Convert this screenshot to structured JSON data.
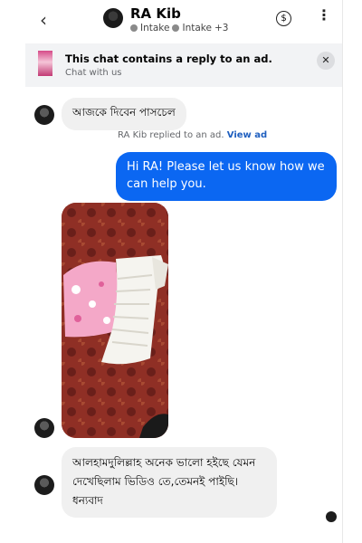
{
  "header": {
    "title": "RA Kib",
    "tags": [
      "Intake",
      "Intake"
    ],
    "tags_more": "+3"
  },
  "banner": {
    "title": "This chat contains a reply to an ad.",
    "subtitle": "Chat with us"
  },
  "messages": {
    "first_incoming": "আজকে দিবেন পাসচেল",
    "system_note": "RA Kib replied to an ad.",
    "system_link": "View ad",
    "outgoing": "Hi RA! Please let us know how we can help you.",
    "last_incoming": "আলহামদুলিল্লাহ অনেক ভালো হইছে যেমন দেখেছিলাম ভিডিও তে,তেমনই পাইছি। ধন্যবাদ"
  },
  "colors": {
    "outgoing_bubble": "#0b67f2",
    "incoming_bubble": "#f0f0f0",
    "banner_bg": "#f2f3f5",
    "link": "#1f5fbf"
  },
  "icons": [
    "back-arrow-icon",
    "dollar-icon",
    "more-vertical-icon",
    "close-icon"
  ]
}
